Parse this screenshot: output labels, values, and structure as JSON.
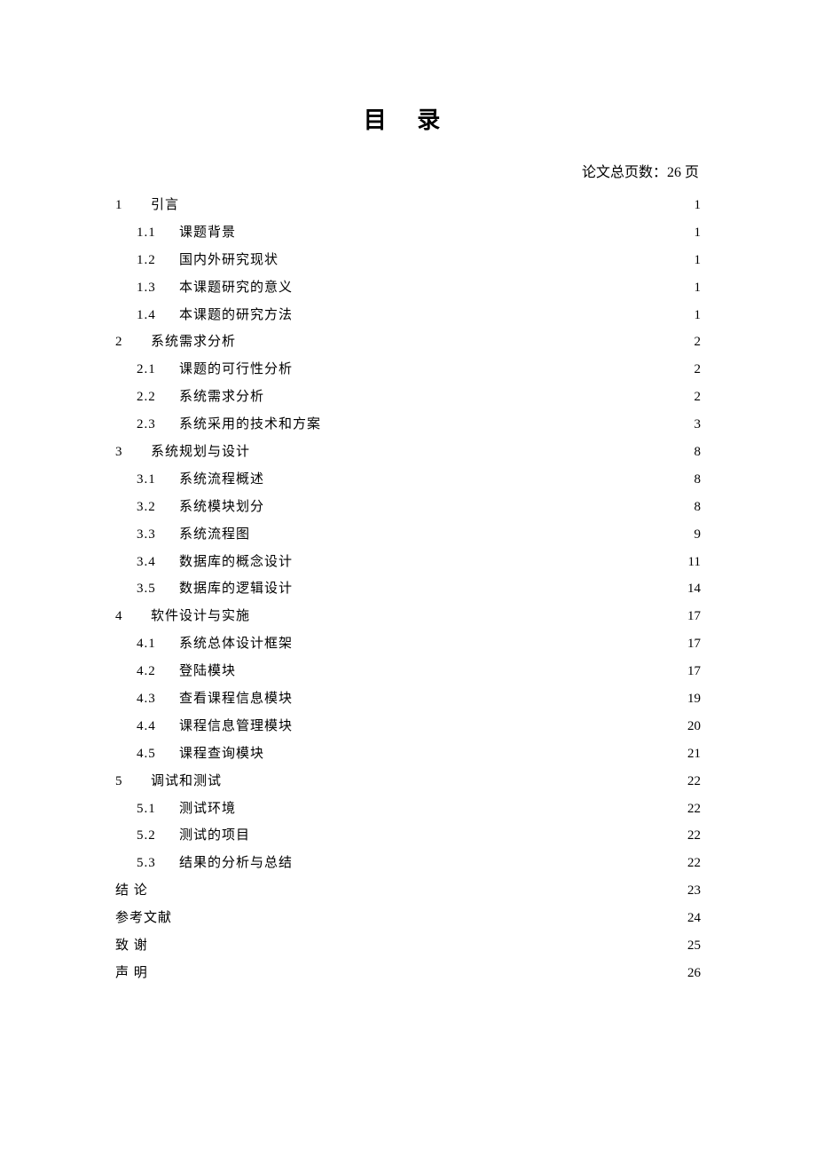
{
  "title": "目 录",
  "page_count_label": "论文总页数：26 页",
  "toc": [
    {
      "level": 1,
      "num": "1",
      "text": "引言",
      "page": "1",
      "spaced": false
    },
    {
      "level": 2,
      "num": "1.1",
      "text": "课题背景",
      "page": "1",
      "spaced": false
    },
    {
      "level": 2,
      "num": "1.2",
      "text": "国内外研究现状",
      "page": "1",
      "spaced": false
    },
    {
      "level": 2,
      "num": "1.3",
      "text": "本课题研究的意义",
      "page": "1",
      "spaced": false
    },
    {
      "level": 2,
      "num": "1.4",
      "text": "本课题的研究方法",
      "page": "1",
      "spaced": false
    },
    {
      "level": 1,
      "num": "2",
      "text": "系统需求分析",
      "page": "2",
      "spaced": false
    },
    {
      "level": 2,
      "num": "2.1",
      "text": "课题的可行性分析",
      "page": "2",
      "spaced": false
    },
    {
      "level": 2,
      "num": "2.2",
      "text": "系统需求分析",
      "page": "2",
      "spaced": false
    },
    {
      "level": 2,
      "num": "2.3",
      "text": "系统采用的技术和方案",
      "page": "3",
      "spaced": false
    },
    {
      "level": 1,
      "num": "3",
      "text": "系统规划与设计",
      "page": "8",
      "spaced": false
    },
    {
      "level": 2,
      "num": "3.1",
      "text": "系统流程概述",
      "page": "8",
      "spaced": false
    },
    {
      "level": 2,
      "num": "3.2",
      "text": "系统模块划分",
      "page": "8",
      "spaced": false
    },
    {
      "level": 2,
      "num": "3.3",
      "text": "系统流程图",
      "page": "9",
      "spaced": false
    },
    {
      "level": 2,
      "num": "3.4",
      "text": "数据库的概念设计",
      "page": "11",
      "spaced": false
    },
    {
      "level": 2,
      "num": "3.5",
      "text": "数据库的逻辑设计",
      "page": "14",
      "spaced": false
    },
    {
      "level": 1,
      "num": "4",
      "text": "软件设计与实施",
      "page": "17",
      "spaced": false
    },
    {
      "level": 2,
      "num": "4.1",
      "text": "系统总体设计框架",
      "page": "17",
      "spaced": false
    },
    {
      "level": 2,
      "num": "4.2",
      "text": "登陆模块",
      "page": "17",
      "spaced": false
    },
    {
      "level": 2,
      "num": "4.3",
      "text": "查看课程信息模块",
      "page": "19",
      "spaced": false
    },
    {
      "level": 2,
      "num": "4.4",
      "text": "课程信息管理模块",
      "page": "20",
      "spaced": false
    },
    {
      "level": 2,
      "num": "4.5",
      "text": "课程查询模块",
      "page": "21",
      "spaced": false
    },
    {
      "level": 1,
      "num": "5",
      "text": "调试和测试",
      "page": "22",
      "spaced": false
    },
    {
      "level": 2,
      "num": "5.1",
      "text": "测试环境",
      "page": "22",
      "spaced": false
    },
    {
      "level": 2,
      "num": "5.2",
      "text": "测试的项目",
      "page": "22",
      "spaced": false
    },
    {
      "level": 2,
      "num": "5.3",
      "text": "结果的分析与总结",
      "page": "22",
      "spaced": false
    },
    {
      "level": 1,
      "num": "",
      "text": "结    论",
      "page": "23",
      "spaced": false
    },
    {
      "level": 1,
      "num": "",
      "text": "参考文献",
      "page": "24",
      "spaced": false
    },
    {
      "level": 1,
      "num": "",
      "text": "致    谢",
      "page": "25",
      "spaced": false
    },
    {
      "level": 1,
      "num": "",
      "text": "声    明",
      "page": "26",
      "spaced": false
    }
  ]
}
